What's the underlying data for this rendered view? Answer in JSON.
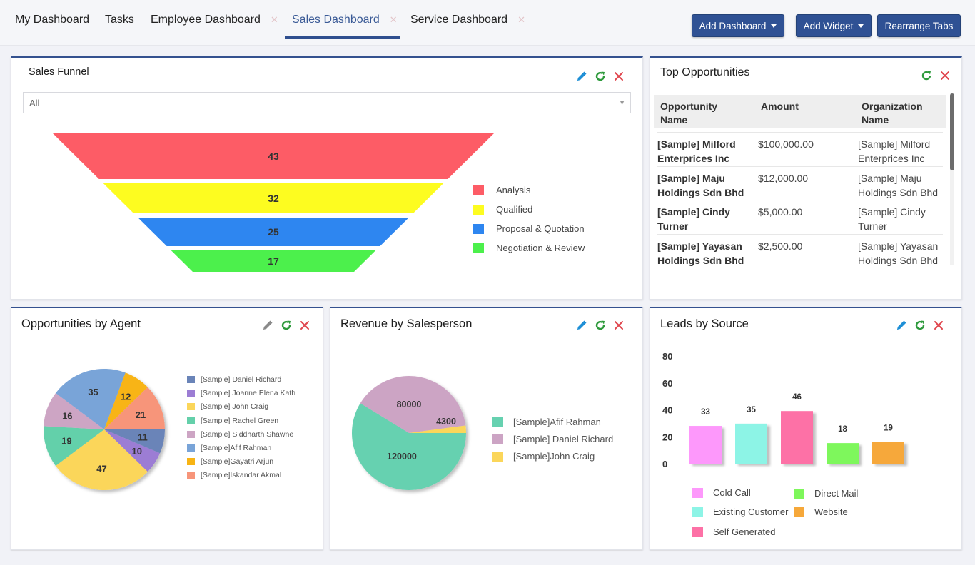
{
  "tabs": [
    {
      "label": "My Dashboard",
      "closable": false,
      "active": false
    },
    {
      "label": "Tasks",
      "closable": false,
      "active": false
    },
    {
      "label": "Employee Dashboard",
      "closable": true,
      "active": false
    },
    {
      "label": "Sales Dashboard",
      "closable": true,
      "active": true
    },
    {
      "label": "Service Dashboard",
      "closable": true,
      "active": false
    }
  ],
  "tab_close_glyph": "✕",
  "toolbar": {
    "add_dashboard": "Add Dashboard",
    "add_widget": "Add Widget",
    "rearrange_tabs": "Rearrange Tabs"
  },
  "colors": {
    "accent": "#2f5194",
    "edit_icon": "#1e8fd6",
    "refresh_icon": "#2e9a3c",
    "close_icon": "#e0454d",
    "edit_icon_disabled": "#8a8a8a"
  },
  "sales_funnel": {
    "title": "Sales Funnel",
    "filter": {
      "selected": "All"
    },
    "icons": [
      "pencil-icon",
      "refresh-icon",
      "close-icon"
    ]
  },
  "top_opportunities": {
    "title": "Top Opportunities",
    "icons": [
      "refresh-icon",
      "close-icon"
    ],
    "columns": [
      "Opportunity Name",
      "Amount",
      "Organization Name"
    ],
    "rows": [
      {
        "name_l1": "[Sample] Milford",
        "name_l2": "Enterprices Inc",
        "amount": "$100,000.00",
        "org_l1": "[Sample] Milford",
        "org_l2": "Enterprices Inc"
      },
      {
        "name_l1": "[Sample] Maju",
        "name_l2": "Holdings Sdn Bhd",
        "amount": "$12,000.00",
        "org_l1": "[Sample] Maju",
        "org_l2": "Holdings Sdn Bhd"
      },
      {
        "name_l1": "[Sample] Cindy",
        "name_l2": "Turner",
        "amount": "$5,000.00",
        "org_l1": "[Sample] Cindy",
        "org_l2": "Turner"
      },
      {
        "name_l1": "[Sample] Yayasan",
        "name_l2": "Holdings Sdn Bhd",
        "amount": "$2,500.00",
        "org_l1": "[Sample] Yayasan",
        "org_l2": "Holdings Sdn Bhd"
      }
    ]
  },
  "opportunities_by_agent": {
    "title": "Opportunities by Agent",
    "icons": [
      "pencil-icon",
      "refresh-icon",
      "close-icon"
    ]
  },
  "revenue_by_salesperson": {
    "title": "Revenue by Salesperson",
    "icons": [
      "pencil-icon",
      "refresh-icon",
      "close-icon"
    ]
  },
  "leads_by_source": {
    "title": "Leads by Source",
    "icons": [
      "pencil-icon",
      "refresh-icon",
      "close-icon"
    ]
  },
  "chart_data": [
    {
      "id": "sales_funnel",
      "type": "funnel",
      "title": "Sales Funnel",
      "categories": [
        "Analysis",
        "Qualified",
        "Proposal & Quotation",
        "Negotiation & Review"
      ],
      "values": [
        43,
        32,
        25,
        17
      ],
      "colors": [
        "#fd5c66",
        "#fdfc20",
        "#2e86f0",
        "#4cf04c"
      ],
      "legend": "right"
    },
    {
      "id": "opportunities_by_agent",
      "type": "pie",
      "title": "Opportunities by Agent",
      "slices": [
        {
          "label": "[Sample] Daniel Richard",
          "value": 11,
          "color": "#6a84b8"
        },
        {
          "label": "[Sample] Joanne Elena Kath",
          "value": 10,
          "color": "#9c7dd4"
        },
        {
          "label": "[Sample] John Craig",
          "value": 47,
          "color": "#fbd65a"
        },
        {
          "label": "[Sample] Rachel Green",
          "value": 19,
          "color": "#64d0aa"
        },
        {
          "label": "[Sample] Siddharth Shawne",
          "value": 16,
          "color": "#cda5c4"
        },
        {
          "label": "[Sample]Afif Rahman",
          "value": 35,
          "color": "#79a4d8"
        },
        {
          "label": "[Sample]Gayatri Arjun",
          "value": 12,
          "color": "#f8b414"
        },
        {
          "label": "[Sample]Iskandar Akmal",
          "value": 21,
          "color": "#f7957a"
        }
      ],
      "legend": "right"
    },
    {
      "id": "revenue_by_salesperson",
      "type": "pie",
      "title": "Revenue by Salesperson",
      "slices": [
        {
          "label": "[Sample]Afif Rahman",
          "value": 120000,
          "color": "#66d1b0"
        },
        {
          "label": "[Sample] Daniel Richard",
          "value": 80000,
          "color": "#cca4c4"
        },
        {
          "label": "[Sample]John Craig",
          "value": 4300,
          "color": "#fbd65a"
        }
      ],
      "legend": "right"
    },
    {
      "id": "leads_by_source",
      "type": "bar",
      "title": "Leads by Source",
      "categories": [
        "Cold Call",
        "Existing Customer",
        "Self Generated",
        "Direct Mail",
        "Website"
      ],
      "values": [
        33,
        35,
        46,
        18,
        19
      ],
      "colors": [
        "#fd98fb",
        "#8df4e6",
        "#fd71a6",
        "#7ef75b",
        "#f6a83a"
      ],
      "yticks": [
        0,
        20,
        40,
        60,
        80
      ],
      "ylim": [
        0,
        80
      ],
      "grid": false,
      "legend": "bottom",
      "xlabel": "",
      "ylabel": ""
    }
  ]
}
